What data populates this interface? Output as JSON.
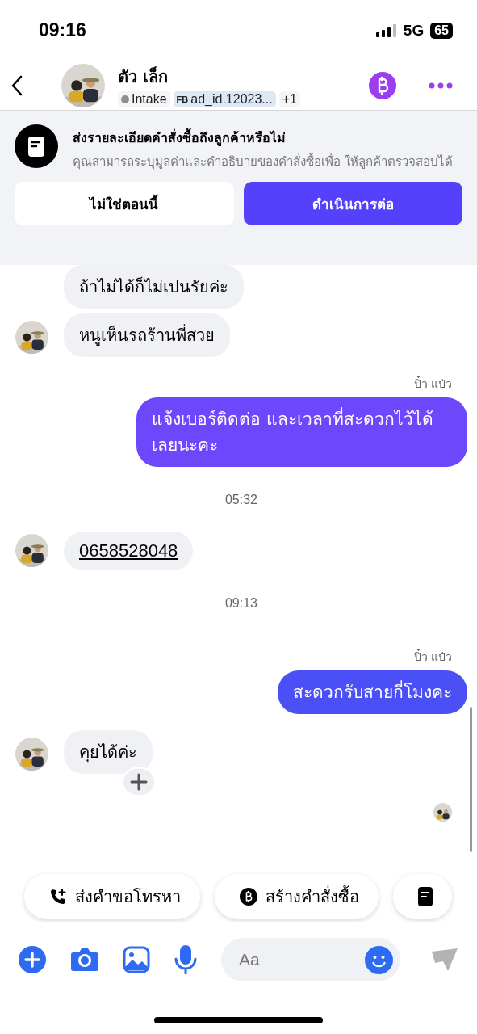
{
  "status_bar": {
    "time": "09:16",
    "network": "5G",
    "battery": "65"
  },
  "header": {
    "name": "ตัว เล็ก",
    "tags": [
      {
        "kind": "stage",
        "label": "Intake",
        "color": "#8e8e93"
      },
      {
        "kind": "source",
        "prefix": "FB",
        "label": "ad_id.12023..."
      },
      {
        "kind": "more",
        "label": "+1"
      }
    ]
  },
  "banner": {
    "title": "ส่งรายละเอียดคำสั่งซื้อถึงลูกค้าหรือไม่",
    "body": "คุณสามารถระบุมูลค่าและคำอธิบายของคำสั่งซื้อเพื่อ ให้ลูกค้าตรวจสอบได้",
    "buttons": [
      {
        "label": "ไม่ใช่ตอนนี้",
        "kind": "secondary"
      },
      {
        "label": "ดำเนินการต่อ",
        "kind": "primary"
      }
    ]
  },
  "messages": [
    {
      "kind": "incoming",
      "text": "ถ้าไม่ได้ก็ไม่เปนรัยค่ะ",
      "avatar": false,
      "link": false,
      "reaction": false
    },
    {
      "kind": "incoming",
      "text": "หนูเห็นรถร้านพี่สวย",
      "avatar": true,
      "link": false,
      "reaction": false
    },
    {
      "kind": "outgoing",
      "sender": "ปิ๋ว แป๋ว",
      "text": "แจ้งเบอร์ติดต่อ  และเวลาที่สะดวกไว้ได้เลยนะคะ",
      "color": "#6d47fb"
    },
    {
      "kind": "time",
      "text": "05:32"
    },
    {
      "kind": "incoming",
      "text": "0658528048",
      "avatar": true,
      "link": true,
      "reaction": false
    },
    {
      "kind": "time",
      "text": "09:13"
    },
    {
      "kind": "outgoing",
      "sender": "ปิ๋ว แป๋ว",
      "text": "สะดวกรับสายกี่โมงคะ",
      "color": "#4a50f5"
    },
    {
      "kind": "incoming",
      "text": "คุยได้ค่ะ",
      "avatar": true,
      "link": false,
      "reaction": true
    },
    {
      "kind": "seen"
    }
  ],
  "quick_replies": [
    {
      "kind": "call",
      "label": "ส่งคำขอโทรหา"
    },
    {
      "kind": "order",
      "label": "สร้างคำสั่งซื้อ"
    },
    {
      "kind": "note"
    }
  ],
  "composer": {
    "placeholder": "Aa"
  }
}
